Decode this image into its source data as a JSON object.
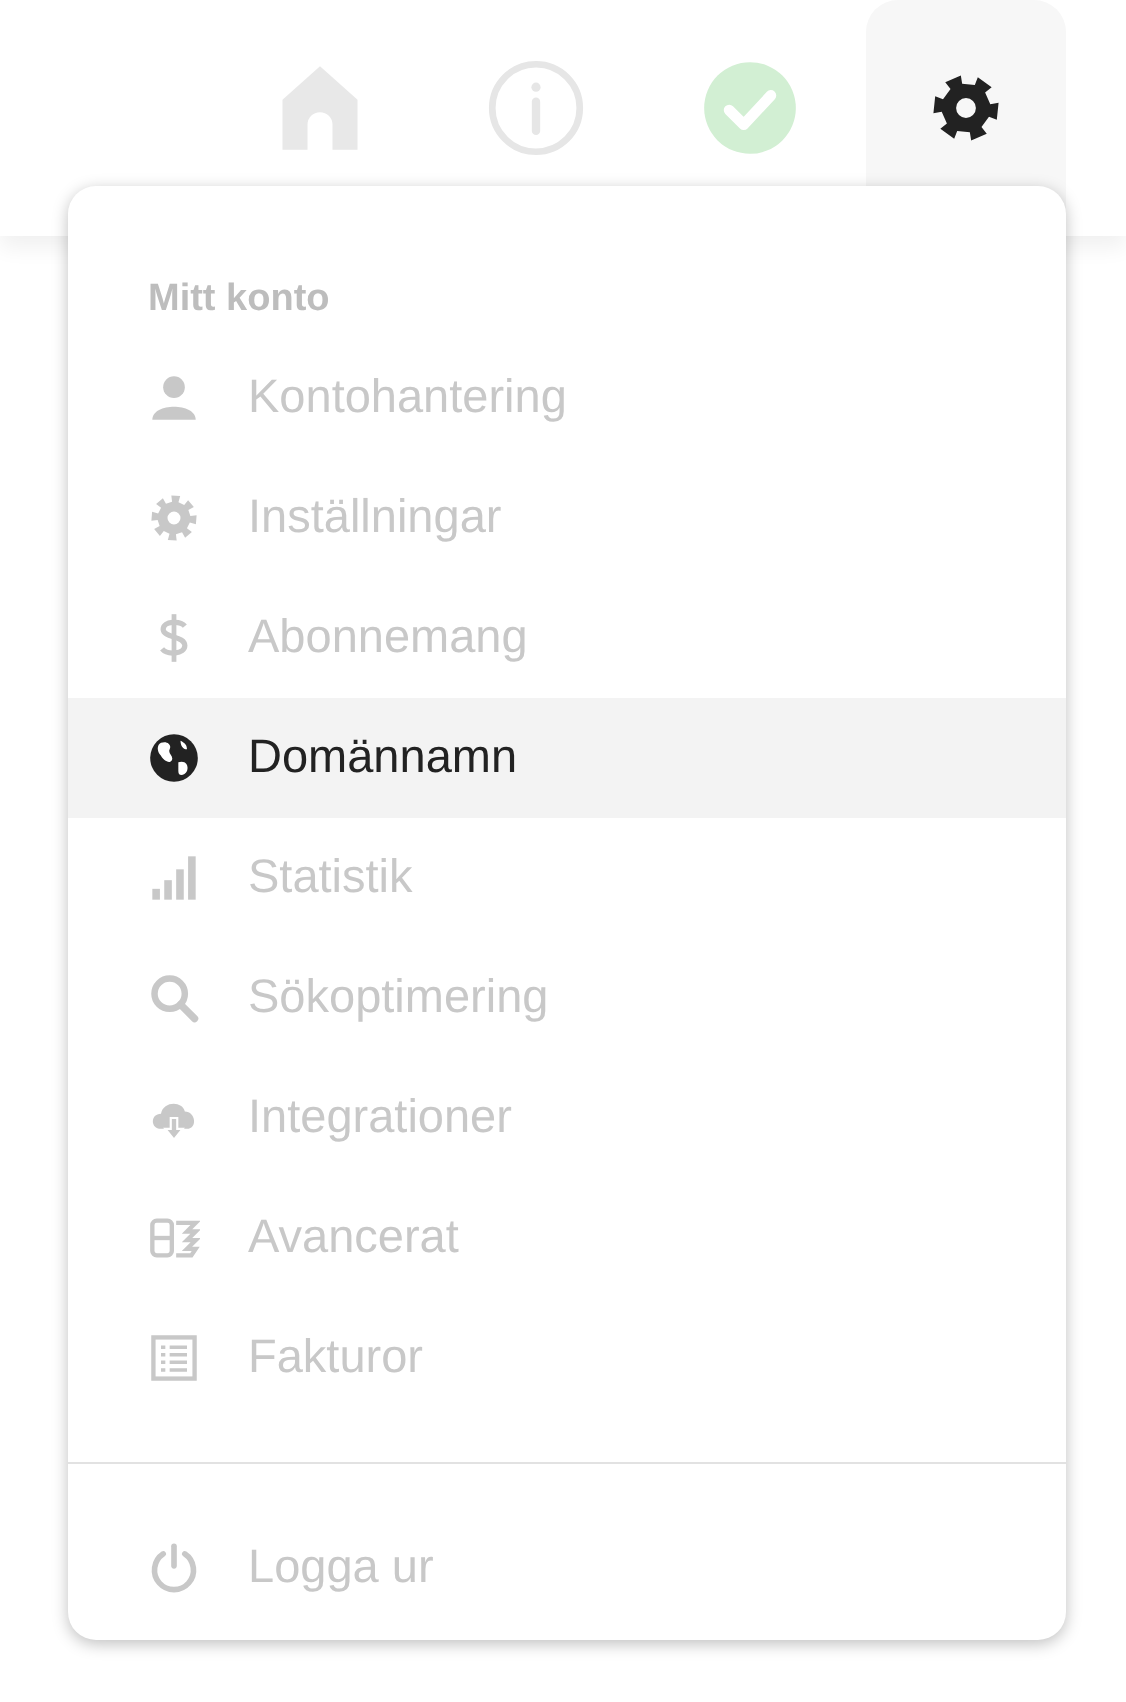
{
  "top_nav": [
    {
      "selected": false
    },
    {
      "selected": false
    },
    {
      "selected": false
    },
    {
      "selected": true
    }
  ],
  "menu": {
    "heading": "Mitt konto",
    "items": [
      {
        "label": "Kontohantering",
        "selected": false
      },
      {
        "label": "Inställningar",
        "selected": false
      },
      {
        "label": "Abonnemang",
        "selected": false
      },
      {
        "label": "Domännamn",
        "selected": true
      },
      {
        "label": "Statistik",
        "selected": false
      },
      {
        "label": "Sökoptimering",
        "selected": false
      },
      {
        "label": "Integrationer",
        "selected": false
      },
      {
        "label": "Avancerat",
        "selected": false
      },
      {
        "label": "Fakturor",
        "selected": false
      }
    ],
    "footer_items": [
      {
        "label": "Logga ur",
        "selected": false
      }
    ]
  }
}
